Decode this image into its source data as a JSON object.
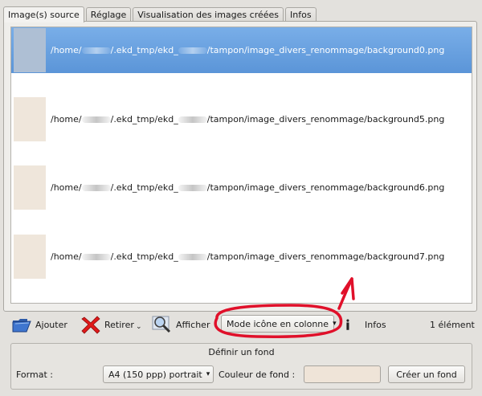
{
  "tabs": [
    {
      "label": "Image(s) source",
      "active": true
    },
    {
      "label": "Réglage",
      "active": false
    },
    {
      "label": "Visualisation des images créées",
      "active": false
    },
    {
      "label": "Infos",
      "active": false
    }
  ],
  "files": [
    {
      "path_start": "/home/",
      "path_mid": "/.ekd_tmp/ekd_",
      "path_end": "/tampon/image_divers_renommage/background0.png",
      "selected": true
    },
    {
      "path_start": "/home/",
      "path_mid": "/.ekd_tmp/ekd_",
      "path_end": "/tampon/image_divers_renommage/background5.png",
      "selected": false
    },
    {
      "path_start": "/home/",
      "path_mid": "/.ekd_tmp/ekd_",
      "path_end": "/tampon/image_divers_renommage/background6.png",
      "selected": false
    },
    {
      "path_start": "/home/",
      "path_mid": "/.ekd_tmp/ekd_",
      "path_end": "/tampon/image_divers_renommage/background7.png",
      "selected": false
    }
  ],
  "toolbar": {
    "add_label": "Ajouter",
    "remove_label": "Retirer",
    "show_label": "Afficher",
    "view_mode": "Mode icône en colonne",
    "info_label": "Infos",
    "count": "1 élément"
  },
  "background": {
    "title": "Définir un fond",
    "format_label": "Format :",
    "format_value": "A4 (150 ppp) portrait",
    "color_label": "Couleur de fond :",
    "color_value": "#efe4d8",
    "create_label": "Créer un fond"
  },
  "colors": {
    "selection": "#5b95d8",
    "annotation": "#e0102a"
  }
}
